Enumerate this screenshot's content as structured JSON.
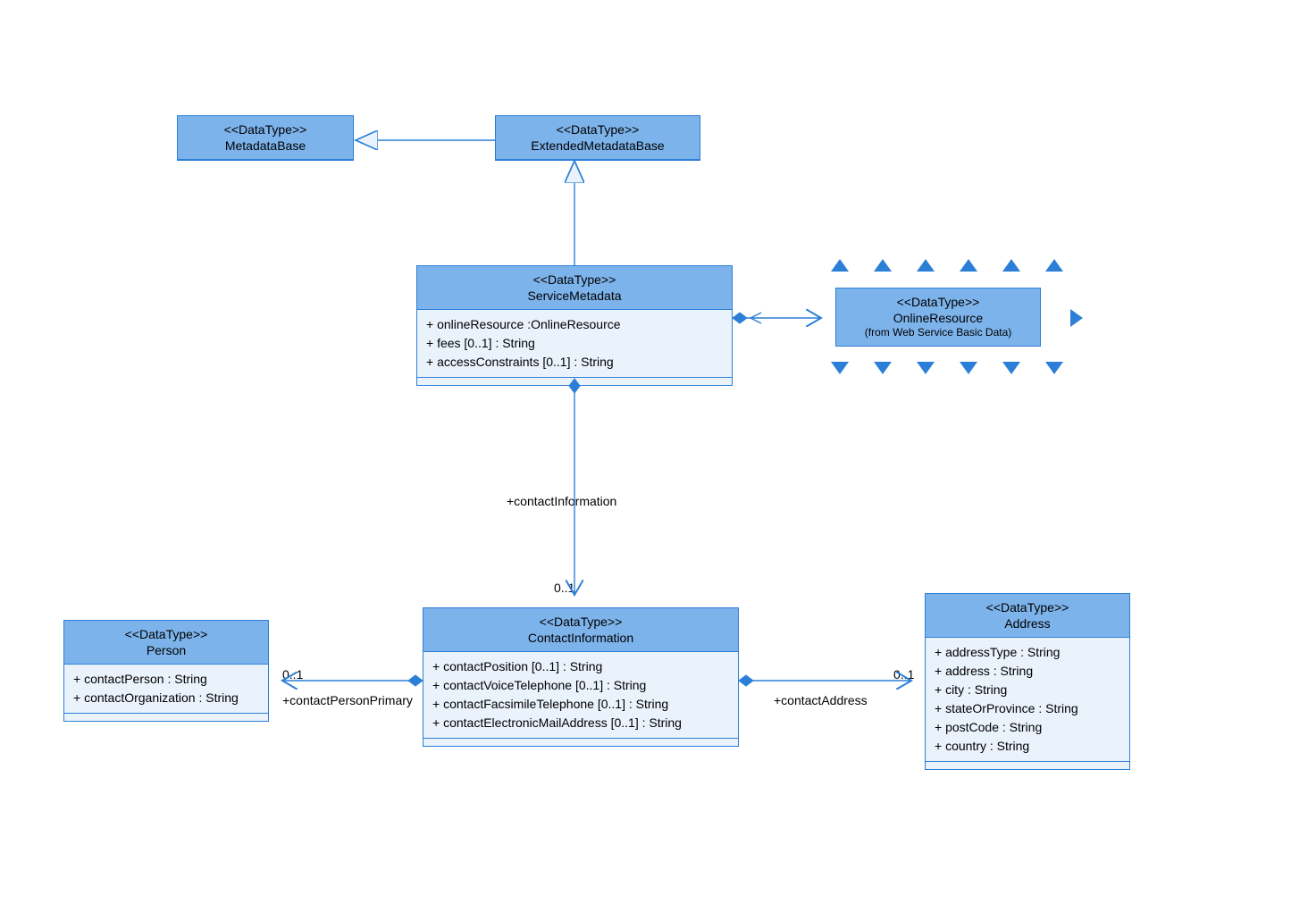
{
  "classes": {
    "metadataBase": {
      "stereotype": "<<DataType>>",
      "name": "MetadataBase"
    },
    "extendedMetadataBase": {
      "stereotype": "<<DataType>>",
      "name": "ExtendedMetadataBase"
    },
    "serviceMetadata": {
      "stereotype": "<<DataType>>",
      "name": "ServiceMetadata",
      "attrs": [
        "+ onlineResource :OnlineResource",
        "+ fees [0..1] : String",
        "+ accessConstraints [0..1] : String"
      ]
    },
    "onlineResource": {
      "stereotype": "<<DataType>>",
      "name": "OnlineResource",
      "from": "(from Web Service Basic Data)"
    },
    "contactInformation": {
      "stereotype": "<<DataType>>",
      "name": "ContactInformation",
      "attrs": [
        "+ contactPosition [0..1] : String",
        "+ contactVoiceTelephone [0..1] : String",
        "+ contactFacsimileTelephone [0..1] : String",
        "+ contactElectronicMailAddress [0..1] : String"
      ]
    },
    "person": {
      "stereotype": "<<DataType>>",
      "name": "Person",
      "attrs": [
        "+ contactPerson : String",
        "+ contactOrganization : String"
      ]
    },
    "address": {
      "stereotype": "<<DataType>>",
      "name": "Address",
      "attrs": [
        "+ addressType : String",
        "+ address : String",
        "+ city : String",
        "+ stateOrProvince : String",
        "+ postCode : String",
        "+ country : String"
      ]
    }
  },
  "associations": {
    "contactInformation": {
      "role": "+contactInformation",
      "mult": "0..1"
    },
    "contactPersonPrimary": {
      "role": "+contactPersonPrimary",
      "mult": "0..1"
    },
    "contactAddress": {
      "role": "+contactAddress",
      "mult": "0..1"
    }
  },
  "colors": {
    "headerFill": "#7db3eb",
    "bodyFill": "#eaf2fc",
    "border": "#2b7fd6",
    "line": "#2b7fd6",
    "hollowArrowFill": "#eaf2fc"
  }
}
